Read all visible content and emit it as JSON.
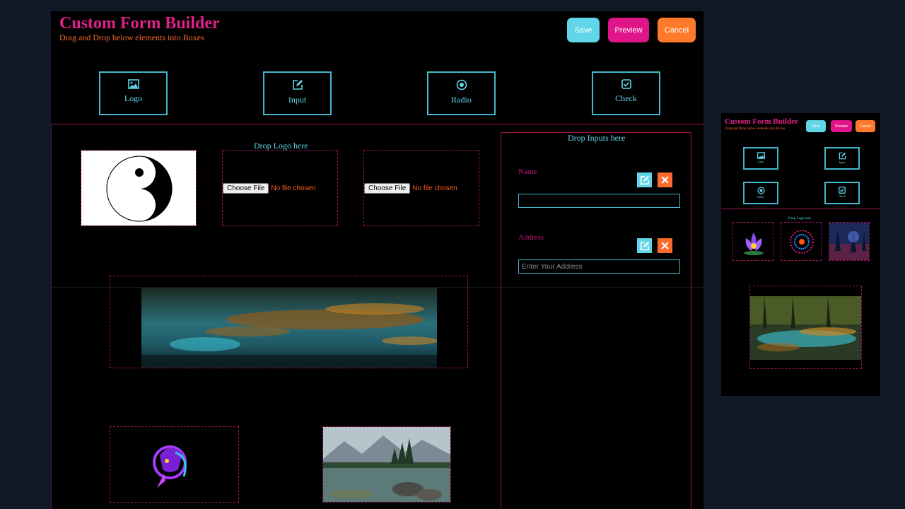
{
  "header": {
    "title": "Custom Form Builder",
    "subtitle": "Drag and Drop below elements into Boxes",
    "save_label": "Save",
    "preview_label": "Preview",
    "cancel_label": "Cancel"
  },
  "toolbox": [
    {
      "label": "Logo",
      "icon": "image-icon"
    },
    {
      "label": "Input",
      "icon": "edit-icon"
    },
    {
      "label": "Radio",
      "icon": "radio-icon"
    },
    {
      "label": "Check",
      "icon": "checkbox-icon"
    }
  ],
  "logo_area": {
    "caption": "Drop Logo here",
    "file_button": "Choose File",
    "file_status": "No file chosen"
  },
  "inputs_area": {
    "caption": "Drop Inputs here",
    "fields": [
      {
        "label": "Name",
        "value": "",
        "placeholder": ""
      },
      {
        "label": "Address",
        "value": "",
        "placeholder": "Enter Your Address"
      }
    ]
  },
  "preview": {
    "title": "Custom Form Builder",
    "subtitle": "Drag and Drop below elements into Boxes",
    "save_label": "Save",
    "preview_label": "Preview",
    "cancel_label": "Cancel",
    "tools": [
      "Logo",
      "Input",
      "Radio",
      "Check"
    ],
    "logo_caption": "Drop Logo here"
  },
  "colors": {
    "accent_pink": "#e0218a",
    "accent_cyan": "#61d6e8",
    "accent_orange": "#ff7a2a",
    "background": "#000000",
    "page": "#111827"
  }
}
